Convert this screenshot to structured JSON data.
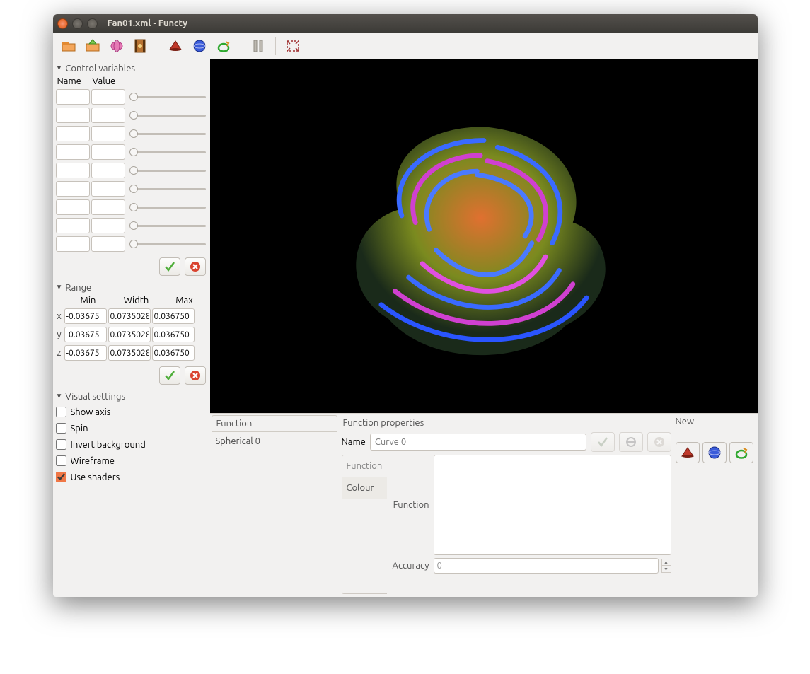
{
  "window": {
    "title": "Fan01.xml - Functy"
  },
  "toolbar_icons": [
    "open",
    "save",
    "export3d",
    "exportanim",
    "cartesian",
    "spherical",
    "curve",
    "pause",
    "fullscreen"
  ],
  "sidebar": {
    "control_variables": {
      "label": "Control variables",
      "name_hdr": "Name",
      "value_hdr": "Value",
      "rows": 9
    },
    "range": {
      "label": "Range",
      "hdr": {
        "min": "Min",
        "width": "Width",
        "max": "Max"
      },
      "axes": [
        {
          "axis": "x",
          "min": "-0.03675",
          "width": "0.0735028",
          "max": "0.036750"
        },
        {
          "axis": "y",
          "min": "-0.03675",
          "width": "0.0735028",
          "max": "0.036750"
        },
        {
          "axis": "z",
          "min": "-0.03675",
          "width": "0.0735028",
          "max": "0.036750"
        }
      ]
    },
    "visual": {
      "label": "Visual settings",
      "show_axis": {
        "label": "Show axis",
        "checked": false
      },
      "spin": {
        "label": "Spin",
        "checked": false
      },
      "invert_bg": {
        "label": "Invert background",
        "checked": false
      },
      "wireframe": {
        "label": "Wireframe",
        "checked": false
      },
      "use_shaders": {
        "label": "Use shaders",
        "checked": true
      }
    }
  },
  "fn_list": {
    "header": "Function",
    "items": [
      "Spherical 0"
    ]
  },
  "fn_props": {
    "title": "Function properties",
    "name_label": "Name",
    "name_placeholder": "Curve 0",
    "tabs": {
      "function": "Function",
      "colour": "Colour"
    },
    "function_label": "Function",
    "accuracy_label": "Accuracy",
    "accuracy_value": "0",
    "new_label": "New"
  }
}
